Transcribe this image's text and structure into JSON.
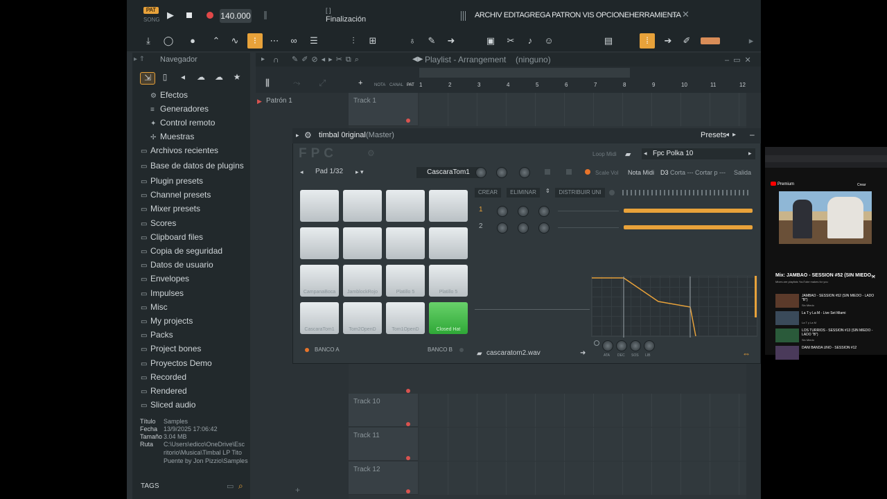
{
  "transport": {
    "pat": "PAT",
    "song": "SONG",
    "tempo": "140.000"
  },
  "hint": {
    "top": "[ ]",
    "main": "Finalización"
  },
  "menu": "ARCHIV EDITAGREGA PATRON VIS OPCIONEHERRAMIENTA",
  "browser": {
    "title": "Navegador",
    "items": [
      {
        "label": "Efectos",
        "sub": true
      },
      {
        "label": "Generadores",
        "sub": true
      },
      {
        "label": "Control remoto",
        "sub": true
      },
      {
        "label": "Muestras",
        "sub": true
      },
      {
        "label": "Archivos recientes"
      },
      {
        "label": "Base de datos de plugins"
      },
      {
        "label": "Plugin presets"
      },
      {
        "label": "Channel presets"
      },
      {
        "label": "Mixer presets"
      },
      {
        "label": "Scores"
      },
      {
        "label": "Clipboard files"
      },
      {
        "label": "Copia de seguridad"
      },
      {
        "label": "Datos de usuario"
      },
      {
        "label": "Envelopes"
      },
      {
        "label": "Impulses"
      },
      {
        "label": "Misc"
      },
      {
        "label": "My projects"
      },
      {
        "label": "Packs"
      },
      {
        "label": "Project bones"
      },
      {
        "label": "Proyectos Demo"
      },
      {
        "label": "Recorded"
      },
      {
        "label": "Rendered"
      },
      {
        "label": "Sliced audio"
      }
    ],
    "meta": {
      "titulo_k": "Título",
      "titulo_v": "Samples",
      "fecha_k": "Fecha",
      "fecha_v": "13/9/2025 17:06:42",
      "tamano_k": "Tamaño",
      "tamano_v": "3.04 MB",
      "ruta_k": "Ruta",
      "ruta_v1": "C:\\Users\\edico\\OneDrive\\Esc",
      "ruta_v2": "ritorio\\Musica\\Timbal LP Tito",
      "ruta_v3": "Puente by Jon Pizzio\\Samples"
    },
    "tags": "TAGS"
  },
  "playlist": {
    "title": "Playlist - Arrangement",
    "pattern_sel": "(ninguno)",
    "sub_labels": {
      "nota": "NOTA",
      "canal": "CANAL",
      "pat": "PAT"
    },
    "bars": [
      "1",
      "2",
      "3",
      "4",
      "5",
      "6",
      "7",
      "8",
      "9",
      "10",
      "11",
      "12"
    ],
    "pattern": "Patrón 1",
    "tracks": [
      "Track 1",
      "Track 10",
      "Track 11",
      "Track 12"
    ]
  },
  "fpc": {
    "title": "timbal 0riginal",
    "subtitle": "(Master)",
    "presets": "Presets",
    "logo": "FPC",
    "loop_midi": "Loop Midi",
    "preset_name": "Fpc Polka 10",
    "pad_sel": "Pad 1/32",
    "pad_name": "CascaraTom1",
    "scale_vol": "Scale Vol",
    "nota_midi": "Nota Midi",
    "note": "D3",
    "corta": "Corta --- Cortar p ---",
    "salida": "Salida",
    "crear": "CREAR",
    "eliminar": "ELIMINAR",
    "distribuir": "DISTRIBUIR UNI",
    "layers": [
      "1",
      "2"
    ],
    "pads": [
      "",
      "",
      "",
      "",
      "",
      "",
      "",
      "",
      "CampanaBoca",
      "JamblockRojo",
      "Platillo 5",
      "Platillo 5",
      "CascaraTom1",
      "Tom2OpenD",
      "Tom1OpenD",
      "Closed Hat"
    ],
    "banco_a": "BANCO A",
    "banco_b": "BANCO B",
    "sample": "cascaratom2.wav",
    "env_labels": [
      "ATA",
      "DEC",
      "SOS",
      "LIB"
    ]
  },
  "yt": {
    "premium": "Premium",
    "mix_title": "Mix: JAMBAO - SESSION #52 (SIN MIEDO...",
    "mix_sub": "Mixes are playlists YouTube makes for you",
    "items": [
      {
        "title": "JAMBAO - SESSION #52 (SIN MIEDO - LADO \"B\")",
        "ch": "Sin Miedo"
      },
      {
        "title": "La T y La M - Live Set Miami",
        "ch": "La T y La M"
      },
      {
        "title": "LOS TURRIOS - SESSION #13 (SIN MIEDO - LADO \"B\")",
        "ch": "Sin Miedo"
      },
      {
        "title": "DANI BANDA UNO - SESSION #12",
        "ch": ""
      }
    ],
    "crear": "Crear"
  }
}
